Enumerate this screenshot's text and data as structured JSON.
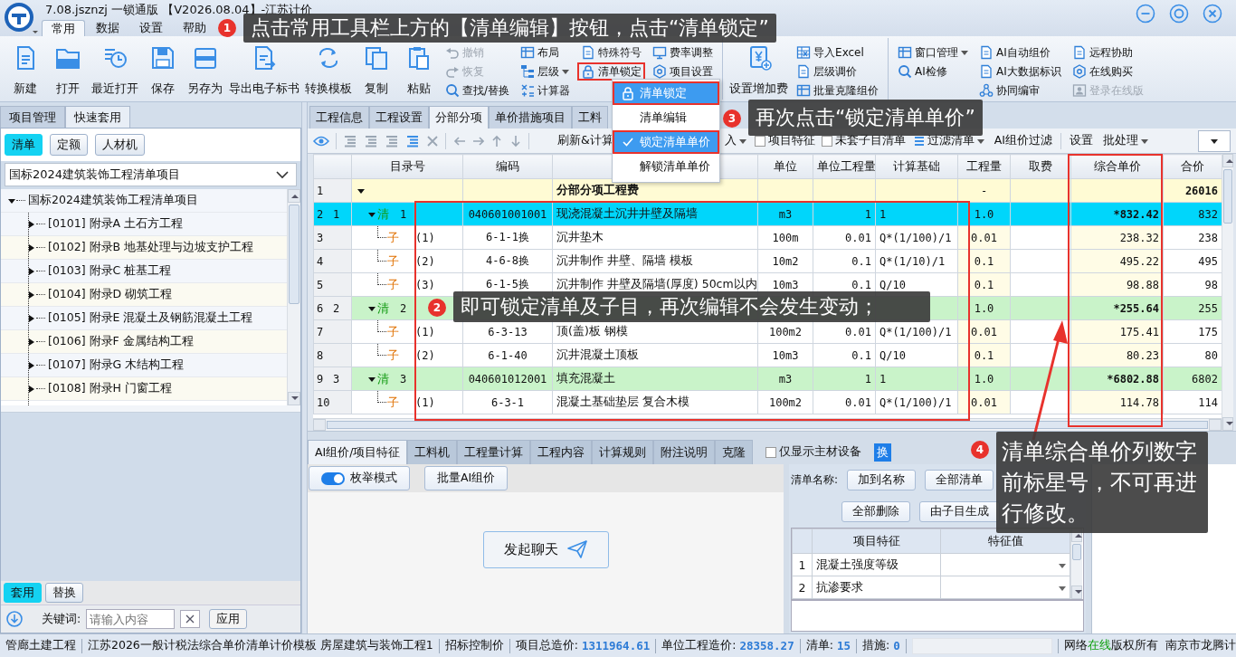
{
  "window": {
    "title": "7.08.jsznzj 一锁通版 【V2026.08.04】-江苏计价",
    "menu_tabs": [
      {
        "label": "常用",
        "selected": true
      },
      {
        "label": "数据",
        "selected": false
      },
      {
        "label": "设置",
        "selected": false
      },
      {
        "label": "帮助",
        "selected": false
      }
    ]
  },
  "ribbon": {
    "groups": [
      {
        "large": [
          {
            "label": "新建"
          },
          {
            "label": "打开"
          },
          {
            "label": "最近打开"
          },
          {
            "label": "保存"
          },
          {
            "label": "另存为"
          },
          {
            "label": "导出电子标书"
          },
          {
            "label": "转换模板"
          },
          {
            "label": "复制"
          },
          {
            "label": "粘贴"
          }
        ],
        "stacks": [
          [
            {
              "label": "撤销",
              "disabled": true,
              "dropdown": false,
              "highlighted": false
            },
            {
              "label": "恢复",
              "disabled": true,
              "dropdown": false,
              "highlighted": false
            },
            {
              "label": "查找/替换",
              "disabled": false,
              "dropdown": false,
              "highlighted": false
            }
          ],
          [
            {
              "label": "布局",
              "disabled": false,
              "dropdown": false,
              "highlighted": false
            },
            {
              "label": "层级",
              "disabled": false,
              "dropdown": true,
              "highlighted": false
            },
            {
              "label": "计算器",
              "disabled": false,
              "dropdown": false,
              "highlighted": false
            }
          ],
          [
            {
              "label": "特殊符号",
              "disabled": false,
              "dropdown": false,
              "highlighted": false
            },
            {
              "label": "清单锁定",
              "disabled": false,
              "dropdown": false,
              "highlighted": true
            }
          ],
          [
            {
              "label": "费率调整",
              "disabled": false,
              "dropdown": false,
              "highlighted": false
            },
            {
              "label": "项目设置",
              "disabled": false,
              "dropdown": false,
              "highlighted": false
            }
          ]
        ]
      },
      {
        "large": [
          {
            "label": "设置增加费"
          }
        ],
        "stacks": [
          [
            {
              "label": "导入Excel",
              "disabled": false,
              "dropdown": false,
              "highlighted": false
            },
            {
              "label": "层级调价",
              "disabled": false,
              "dropdown": false,
              "highlighted": false
            },
            {
              "label": "批量克隆组价",
              "disabled": false,
              "dropdown": false,
              "highlighted": false
            }
          ]
        ]
      },
      {
        "stacks": [
          [
            {
              "label": "窗口管理",
              "disabled": false,
              "dropdown": true,
              "highlighted": false
            },
            {
              "label": "AI检修",
              "disabled": false,
              "dropdown": false,
              "highlighted": false
            }
          ],
          [
            {
              "label": "AI自动组价",
              "disabled": false,
              "dropdown": false,
              "highlighted": false
            },
            {
              "label": "AI大数据标识",
              "disabled": false,
              "dropdown": false,
              "highlighted": false
            },
            {
              "label": "协同编审",
              "disabled": false,
              "dropdown": false,
              "highlighted": false
            }
          ],
          [
            {
              "label": "远程协助",
              "disabled": false,
              "dropdown": false,
              "highlighted": false
            },
            {
              "label": "在线购买",
              "disabled": false,
              "dropdown": false,
              "highlighted": false
            },
            {
              "label": "登录在线版",
              "disabled": true,
              "dropdown": false,
              "highlighted": false
            }
          ]
        ]
      }
    ]
  },
  "lock_menu": {
    "items": [
      {
        "label": "清单锁定",
        "selected": true,
        "checked": false
      },
      {
        "label": "清单编辑",
        "selected": false,
        "checked": false
      },
      {
        "label": "锁定清单单价",
        "selected": true,
        "checked": true
      },
      {
        "label": "解锁清单单价",
        "selected": false,
        "checked": false
      }
    ]
  },
  "left_panel": {
    "tabs": [
      {
        "label": "项目管理",
        "selected": false
      },
      {
        "label": "快速套用",
        "selected": true
      }
    ],
    "filters": [
      {
        "label": "清单",
        "selected": true
      },
      {
        "label": "定额",
        "selected": false
      },
      {
        "label": "人材机",
        "selected": false
      }
    ],
    "library": {
      "value": "国标2024建筑装饰工程清单项目"
    },
    "tree": [
      {
        "label": "国标2024建筑装饰工程清单项目",
        "expanded": true,
        "children": [
          {
            "label": "[0101] 附录A 土石方工程",
            "expanded": false
          },
          {
            "label": "[0102] 附录B 地基处理与边坡支护工程",
            "expanded": false
          },
          {
            "label": "[0103] 附录C 桩基工程",
            "expanded": false
          },
          {
            "label": "[0104] 附录D 砌筑工程",
            "expanded": false
          },
          {
            "label": "[0105] 附录E 混凝土及钢筋混凝土工程",
            "expanded": false
          },
          {
            "label": "[0106] 附录F 金属结构工程",
            "expanded": false
          },
          {
            "label": "[0107] 附录G 木结构工程",
            "expanded": false
          },
          {
            "label": "[0108] 附录H 门窗工程",
            "expanded": false
          }
        ]
      }
    ],
    "modes": [
      {
        "label": "套用",
        "selected": true
      },
      {
        "label": "替换",
        "selected": false
      }
    ],
    "keyword": {
      "label": "关键词:",
      "placeholder": "请输入内容"
    },
    "apply_button": "应用"
  },
  "main": {
    "tabs": [
      {
        "label": "工程信息",
        "selected": false
      },
      {
        "label": "工程设置",
        "selected": false
      },
      {
        "label": "分部分项",
        "selected": true
      },
      {
        "label": "单价措施项目",
        "selected": false
      },
      {
        "label": "工料",
        "selected": false
      }
    ],
    "toolbar": {
      "refresh": "刷新&计算",
      "import": "入",
      "checks": [
        {
          "label": "项目特征",
          "checked": false
        },
        {
          "label": "未套子目清单",
          "checked": false
        }
      ],
      "filter": "过滤清单",
      "ai_filter": "AI组价过滤",
      "settings": "设置",
      "batch": "批处理"
    },
    "table": {
      "columns": [
        "目录号",
        "编码",
        "单位",
        "单位工程量",
        "计算基础",
        "工程量",
        "取费",
        "综合单价",
        "合价"
      ],
      "rows": [
        {
          "kind": "section",
          "row": "1",
          "name": "分部分项工程费",
          "quantity": "-",
          "total": "26016",
          "selected": false,
          "expanded": true
        },
        {
          "kind": "bill",
          "row": "2",
          "seq": "1",
          "marker": "清",
          "no": "1",
          "code": "040601001001",
          "name": "现浇混凝土沉井井壁及隔墙",
          "unit": "m3",
          "unit_qty": "1",
          "basis": "1",
          "quantity": "1.0",
          "price": "*832.42",
          "total": "832",
          "selected": true,
          "expanded": true
        },
        {
          "kind": "item",
          "row": "3",
          "marker": "子",
          "no": "(1)",
          "code": "6-1-1换",
          "name": "沉井垫木",
          "unit": "100m",
          "unit_qty": "0.01",
          "basis": "Q*(1/100)/1",
          "quantity": "0.01",
          "price": "238.32",
          "total": "238",
          "selected": false,
          "expanded": false
        },
        {
          "kind": "item",
          "row": "4",
          "marker": "子",
          "no": "(2)",
          "code": "4-6-8换",
          "name": "沉井制作 井壁、隔墙 模板",
          "unit": "10m2",
          "unit_qty": "0.1",
          "basis": "Q*(1/10)/1",
          "quantity": "0.1",
          "price": "495.22",
          "total": "495",
          "selected": false,
          "expanded": false
        },
        {
          "kind": "item",
          "row": "5",
          "marker": "子",
          "no": "(3)",
          "code": "6-1-5换",
          "name": "沉井制作 井壁及隔墙(厚度) 50cm以内",
          "unit": "10m3",
          "unit_qty": "0.1",
          "basis": "Q/10",
          "quantity": "0.1",
          "price": "98.88",
          "total": "98",
          "selected": false,
          "expanded": false
        },
        {
          "kind": "bill",
          "row": "6",
          "seq": "2",
          "marker": "清",
          "no": "2",
          "quantity": "1.0",
          "price": "*255.64",
          "total": "255",
          "selected": false,
          "expanded": true
        },
        {
          "kind": "item",
          "row": "7",
          "marker": "子",
          "no": "(1)",
          "code": "6-3-13",
          "name": "顶(盖)板 钢模",
          "unit": "100m2",
          "unit_qty": "0.01",
          "basis": "Q*(1/100)/1",
          "quantity": "0.01",
          "price": "175.41",
          "total": "175",
          "selected": false,
          "expanded": false
        },
        {
          "kind": "item",
          "row": "8",
          "marker": "子",
          "no": "(2)",
          "code": "6-1-40",
          "name": "沉井混凝土顶板",
          "unit": "10m3",
          "unit_qty": "0.1",
          "basis": "Q/10",
          "quantity": "0.1",
          "price": "80.23",
          "total": "80",
          "selected": false,
          "expanded": false
        },
        {
          "kind": "bill",
          "row": "9",
          "seq": "3",
          "marker": "清",
          "no": "3",
          "code": "040601012001",
          "name": "填充混凝土",
          "unit": "m3",
          "unit_qty": "1",
          "basis": "1",
          "quantity": "1.0",
          "price": "*6802.88",
          "total": "6802",
          "selected": false,
          "expanded": true
        },
        {
          "kind": "item",
          "row": "10",
          "marker": "子",
          "no": "(1)",
          "code": "6-3-1",
          "name": "混凝土基础垫层 复合木模",
          "unit": "100m2",
          "unit_qty": "0.01",
          "basis": "Q*(1/100)/1",
          "quantity": "0.01",
          "price": "114.78",
          "total": "114",
          "selected": false,
          "expanded": false
        }
      ]
    }
  },
  "detail": {
    "tabs": [
      {
        "label": "AI组价/项目特征",
        "selected": true
      },
      {
        "label": "工料机",
        "selected": false
      },
      {
        "label": "工程量计算",
        "selected": false
      },
      {
        "label": "工程内容",
        "selected": false
      },
      {
        "label": "计算规则",
        "selected": false
      },
      {
        "label": "附注说明",
        "selected": false
      },
      {
        "label": "克隆",
        "selected": false
      }
    ],
    "main_only": {
      "label": "仅显示主材设备",
      "checked": false
    },
    "swap_button": "换",
    "mode_toggle": {
      "label": "枚举模式",
      "on": true
    },
    "batch_button": "批量AI组价",
    "chat_button": "发起聊天",
    "bill_name_label": "清单名称:",
    "name_buttons": [
      "加到名称",
      "全部清单",
      "全部删除",
      "由子目生成"
    ],
    "features": {
      "columns": [
        "项目特征",
        "特征值"
      ],
      "rows": [
        {
          "no": "1",
          "name": "混凝土强度等级"
        },
        {
          "no": "2",
          "name": "抗渗要求"
        }
      ]
    }
  },
  "status_bar": {
    "project": "管廊土建工程",
    "template": "江苏2026一般计税法综合单价清单计价模板 房屋建筑与装饰工程1",
    "price_type": "招标控制价",
    "total": {
      "label": "项目总造价:",
      "value": "1311964.61"
    },
    "unit_total": {
      "label": "单位工程造价:",
      "value": "28358.27"
    },
    "bills": {
      "label": "清单:",
      "value": "15"
    },
    "measures": {
      "label": "措施:",
      "value": "0"
    },
    "network": {
      "label": "网络",
      "status": "在线"
    },
    "copyright": "版权所有",
    "company": "南京市龙腾计"
  },
  "callouts": [
    {
      "number": "1",
      "text": "点击常用工具栏上方的【清单编辑】按钮，点击“清单锁定”"
    },
    {
      "number": "2",
      "text": "即可锁定清单及子目，再次编辑不会发生变动；"
    },
    {
      "number": "3",
      "text": "再次点击“锁定清单单价”"
    },
    {
      "number": "4",
      "text": "清单综合单价列数字前标星号，不可再进行修改。"
    }
  ]
}
